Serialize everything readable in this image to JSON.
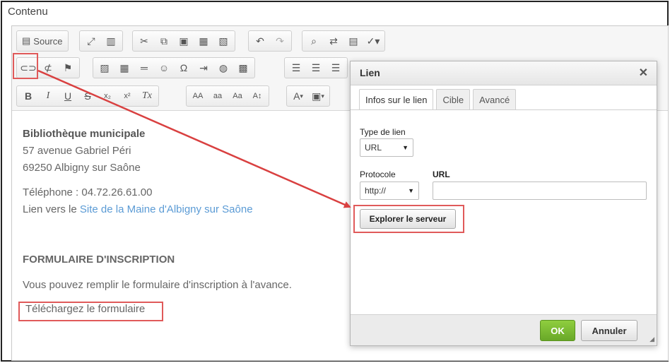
{
  "section": {
    "label": "Contenu"
  },
  "toolbar": {
    "source_label": "Source",
    "icons": {
      "source": "source-icon",
      "maximize": "maximize-icon",
      "blocks": "show-blocks-icon",
      "cut": "cut-icon",
      "copy": "copy-icon",
      "paste": "paste-icon",
      "paste_text": "paste-text-icon",
      "paste_word": "paste-word-icon",
      "undo": "undo-icon",
      "redo": "redo-icon",
      "find": "find-icon",
      "replace": "replace-icon",
      "select_all": "select-all-icon",
      "spellcheck": "spellcheck-icon",
      "link": "link-icon",
      "unlink": "unlink-icon",
      "anchor": "anchor-icon",
      "image": "image-icon",
      "table": "table-icon",
      "hr": "horizontal-rule-icon",
      "smiley": "smiley-icon",
      "special_char": "special-char-icon",
      "page_break": "page-break-icon",
      "iframe": "iframe-icon",
      "flash": "flash-icon"
    },
    "glyphs": {
      "bold": "B",
      "italic": "I",
      "underline": "U",
      "strike": "S",
      "subscript": "x₂",
      "superscript": "x²",
      "remove_format": "Tx",
      "upper": "AA",
      "lower": "aa",
      "capitalize": "Aa",
      "text_color": "A",
      "bg_color": "A",
      "special": "Ω"
    }
  },
  "content": {
    "org_name": "Bibliothèque municipale",
    "address_line1": "57 avenue Gabriel Péri",
    "address_line2": "69250 Albigny sur Saône",
    "phone": "Téléphone : 04.72.26.61.00",
    "link_prefix": "Lien vers le ",
    "link_text": "Site de la Maine d'Albigny sur Saône",
    "form_heading": "FORMULAIRE D'INSCRIPTION",
    "form_desc": "Vous pouvez remplir le formulaire d'inscription à l'avance.",
    "download_link": "Téléchargez le formulaire"
  },
  "dialog": {
    "title": "Lien",
    "close_icon": "close-icon",
    "close_glyph": "✕",
    "tabs": [
      {
        "label": "Infos sur le lien",
        "active": true
      },
      {
        "label": "Cible",
        "active": false
      },
      {
        "label": "Avancé",
        "active": false
      }
    ],
    "link_type_label": "Type de lien",
    "link_type_value": "URL",
    "protocol_label": "Protocole",
    "protocol_value": "http://",
    "url_label": "URL",
    "url_value": "",
    "browse_button": "Explorer le serveur",
    "ok_button": "OK",
    "cancel_button": "Annuler"
  },
  "colors": {
    "highlight": "#e05a5a",
    "arrow": "#d94040",
    "link": "#5b9bd5",
    "ok_green": "#76b82a"
  }
}
